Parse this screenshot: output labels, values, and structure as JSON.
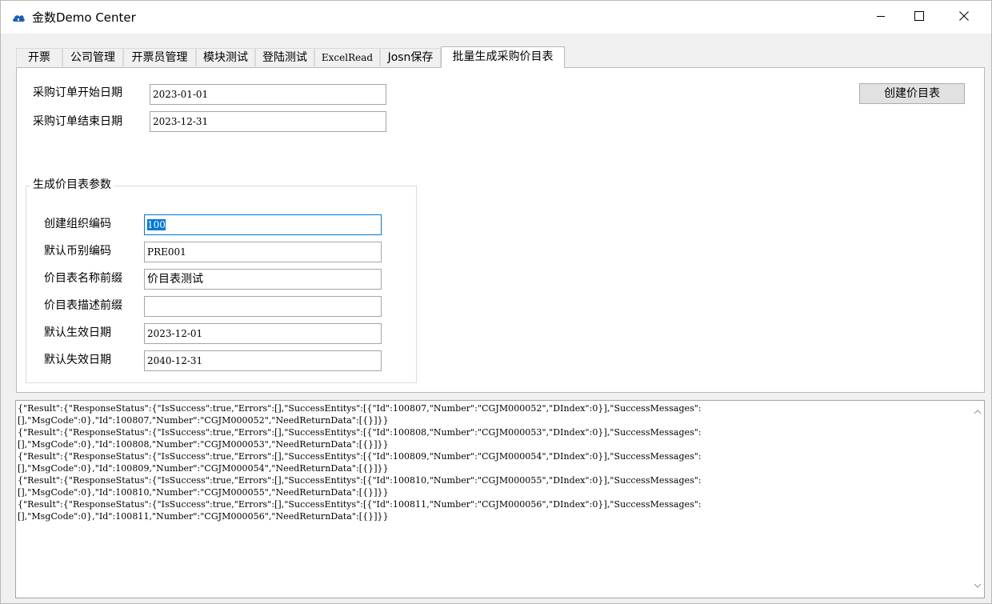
{
  "window": {
    "title": "金数Demo Center"
  },
  "tabs": [
    {
      "label": "开票"
    },
    {
      "label": "公司管理"
    },
    {
      "label": "开票员管理"
    },
    {
      "label": "模块测试"
    },
    {
      "label": "登陆测试"
    },
    {
      "label": "ExcelRead"
    },
    {
      "label": "Josn保存"
    },
    {
      "label": "批量生成采购价目表"
    }
  ],
  "form": {
    "start_date_label": "采购订单开始日期",
    "start_date_value": "2023-01-01",
    "end_date_label": "采购订单结束日期",
    "end_date_value": "2023-12-31",
    "create_button": "创建价目表",
    "group_title": "生成价目表参数",
    "org_code_label": "创建组织编码",
    "org_code_value": "100",
    "currency_label": "默认币别编码",
    "currency_value": "PRE001",
    "name_prefix_label": "价目表名称前缀",
    "name_prefix_value": "价目表测试",
    "desc_prefix_label": "价目表描述前缀",
    "desc_prefix_value": "",
    "effective_label": "默认生效日期",
    "effective_value": "2023-12-01",
    "expiry_label": "默认失效日期",
    "expiry_value": "2040-12-31"
  },
  "log": {
    "text": "{\"Result\":{\"ResponseStatus\":{\"IsSuccess\":true,\"Errors\":[],\"SuccessEntitys\":[{\"Id\":100807,\"Number\":\"CGJM000052\",\"DIndex\":0}],\"SuccessMessages\":\n[],\"MsgCode\":0},\"Id\":100807,\"Number\":\"CGJM000052\",\"NeedReturnData\":[{}]}}\n{\"Result\":{\"ResponseStatus\":{\"IsSuccess\":true,\"Errors\":[],\"SuccessEntitys\":[{\"Id\":100808,\"Number\":\"CGJM000053\",\"DIndex\":0}],\"SuccessMessages\":\n[],\"MsgCode\":0},\"Id\":100808,\"Number\":\"CGJM000053\",\"NeedReturnData\":[{}]}}\n{\"Result\":{\"ResponseStatus\":{\"IsSuccess\":true,\"Errors\":[],\"SuccessEntitys\":[{\"Id\":100809,\"Number\":\"CGJM000054\",\"DIndex\":0}],\"SuccessMessages\":\n[],\"MsgCode\":0},\"Id\":100809,\"Number\":\"CGJM000054\",\"NeedReturnData\":[{}]}}\n{\"Result\":{\"ResponseStatus\":{\"IsSuccess\":true,\"Errors\":[],\"SuccessEntitys\":[{\"Id\":100810,\"Number\":\"CGJM000055\",\"DIndex\":0}],\"SuccessMessages\":\n[],\"MsgCode\":0},\"Id\":100810,\"Number\":\"CGJM000055\",\"NeedReturnData\":[{}]}}\n{\"Result\":{\"ResponseStatus\":{\"IsSuccess\":true,\"Errors\":[],\"SuccessEntitys\":[{\"Id\":100811,\"Number\":\"CGJM000056\",\"DIndex\":0}],\"SuccessMessages\":\n[],\"MsgCode\":0},\"Id\":100811,\"Number\":\"CGJM000056\",\"NeedReturnData\":[{}]}}"
  },
  "icons": {
    "app": "cloud-app-icon",
    "minimize": "minimize-icon",
    "maximize": "maximize-icon",
    "close": "close-icon",
    "scroll_up": "chevron-up-icon",
    "scroll_down": "chevron-down-icon"
  },
  "colors": {
    "accent": "#0078d7",
    "window_bg": "#f0f0f0",
    "app_icon": "#1a5fb4"
  }
}
